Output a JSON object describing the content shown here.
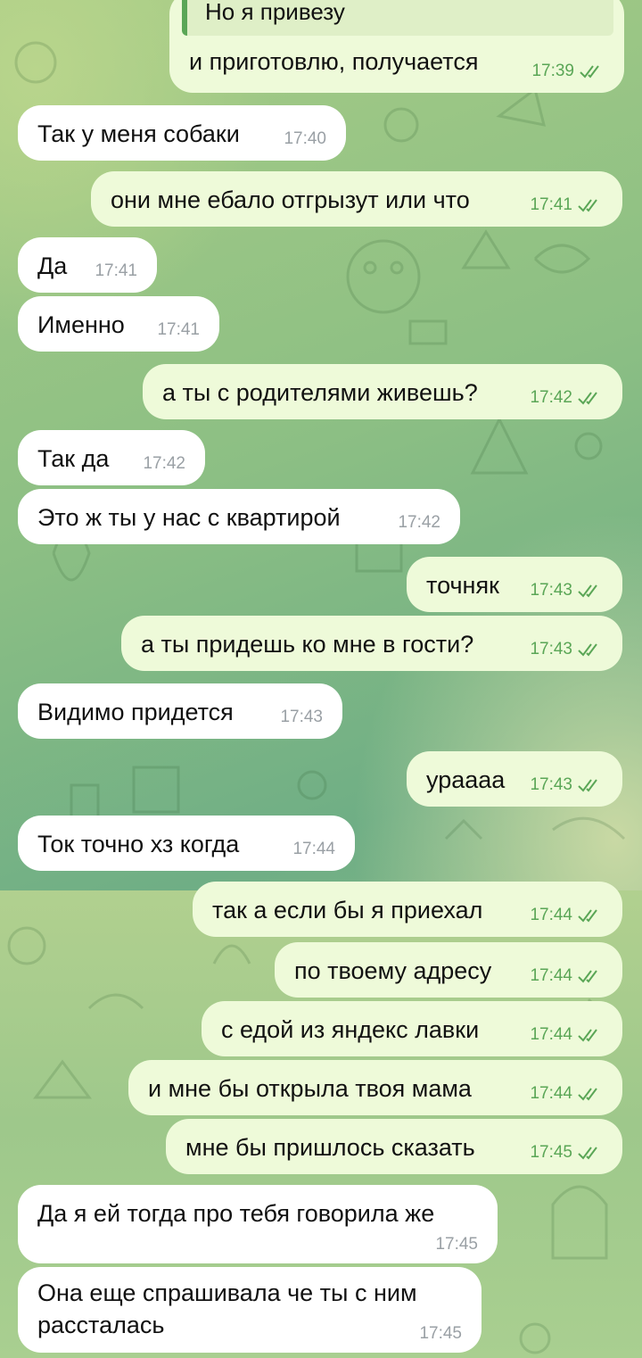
{
  "messages": [
    {
      "id": "m1",
      "direction": "out",
      "text": "и приготовлю, получается",
      "time": "17:39",
      "quote": "Но я привезу"
    },
    {
      "id": "m2",
      "direction": "in",
      "text": "Так у меня собаки",
      "time": "17:40"
    },
    {
      "id": "m3",
      "direction": "out",
      "text": "они мне ебало отгрызут или что",
      "time": "17:41"
    },
    {
      "id": "m4",
      "direction": "in",
      "text": "Да",
      "time": "17:41"
    },
    {
      "id": "m5",
      "direction": "in",
      "text": "Именно",
      "time": "17:41"
    },
    {
      "id": "m6",
      "direction": "out",
      "text": "а ты с родителями живешь?",
      "time": "17:42"
    },
    {
      "id": "m7",
      "direction": "in",
      "text": "Так да",
      "time": "17:42"
    },
    {
      "id": "m8",
      "direction": "in",
      "text": "Это ж ты у нас с квартирой",
      "time": "17:42"
    },
    {
      "id": "m9",
      "direction": "out",
      "text": "точняк",
      "time": "17:43"
    },
    {
      "id": "m10",
      "direction": "out",
      "text": "а ты придешь ко мне в гости?",
      "time": "17:43"
    },
    {
      "id": "m11",
      "direction": "in",
      "text": "Видимо придется",
      "time": "17:43"
    },
    {
      "id": "m12",
      "direction": "out",
      "text": "урاааа",
      "time": "17:43"
    },
    {
      "id": "m13",
      "direction": "in",
      "text": "Ток точно хз когда",
      "time": "17:44"
    },
    {
      "id": "m14",
      "direction": "out",
      "text": "так а если бы я приехал",
      "time": "17:44"
    },
    {
      "id": "m15",
      "direction": "out",
      "text": "по твоему адресу",
      "time": "17:44"
    },
    {
      "id": "m16",
      "direction": "out",
      "text": "с едой из яндекс лавки",
      "time": "17:44"
    },
    {
      "id": "m17",
      "direction": "out",
      "text": "и мне бы открыла твоя мама",
      "time": "17:44"
    },
    {
      "id": "m18",
      "direction": "out",
      "text": "мне бы пришлось сказать",
      "time": "17:45"
    },
    {
      "id": "m19",
      "direction": "in",
      "text": "Да я ей тогда про тебя говорила же",
      "time": "17:45"
    },
    {
      "id": "m20",
      "direction": "in",
      "text_line1": "Она еще спрашивала че ты с ним",
      "text_line2": "рассталась",
      "time": "17:45"
    }
  ],
  "colors": {
    "incoming_bubble": "#ffffff",
    "outgoing_bubble": "#eefad9",
    "read_tick": "#5aa656",
    "time_incoming": "#9aa0a5"
  }
}
